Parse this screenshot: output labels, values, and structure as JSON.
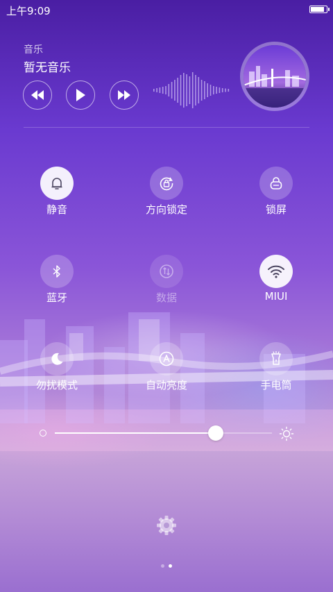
{
  "status_bar": {
    "time": "上午9:09",
    "battery_level": 0.92
  },
  "music": {
    "label": "音乐",
    "title": "暂无音乐",
    "controls": [
      "previous-icon",
      "play-icon",
      "next-icon"
    ]
  },
  "toggles": [
    {
      "label": "静音",
      "icon": "bell-icon",
      "state": "on"
    },
    {
      "label": "方向锁定",
      "icon": "rotation-lock-icon",
      "state": "off"
    },
    {
      "label": "锁屏",
      "icon": "lock-icon",
      "state": "off"
    },
    {
      "label": "蓝牙",
      "icon": "bluetooth-icon",
      "state": "off"
    },
    {
      "label": "数据",
      "icon": "mobile-data-icon",
      "state": "disabled"
    },
    {
      "label": "MIUI",
      "icon": "wifi-icon",
      "state": "on"
    },
    {
      "label": "勿扰模式",
      "icon": "moon-icon",
      "state": "off"
    },
    {
      "label": "自动亮度",
      "icon": "auto-brightness-icon",
      "state": "off"
    },
    {
      "label": "手电筒",
      "icon": "flashlight-icon",
      "state": "off"
    }
  ],
  "brightness": {
    "level": 0.74
  },
  "pager": {
    "pages": 2,
    "current": 2
  },
  "colors": {
    "accent_on": "#ffffff",
    "icon_on": "#4b4560"
  }
}
